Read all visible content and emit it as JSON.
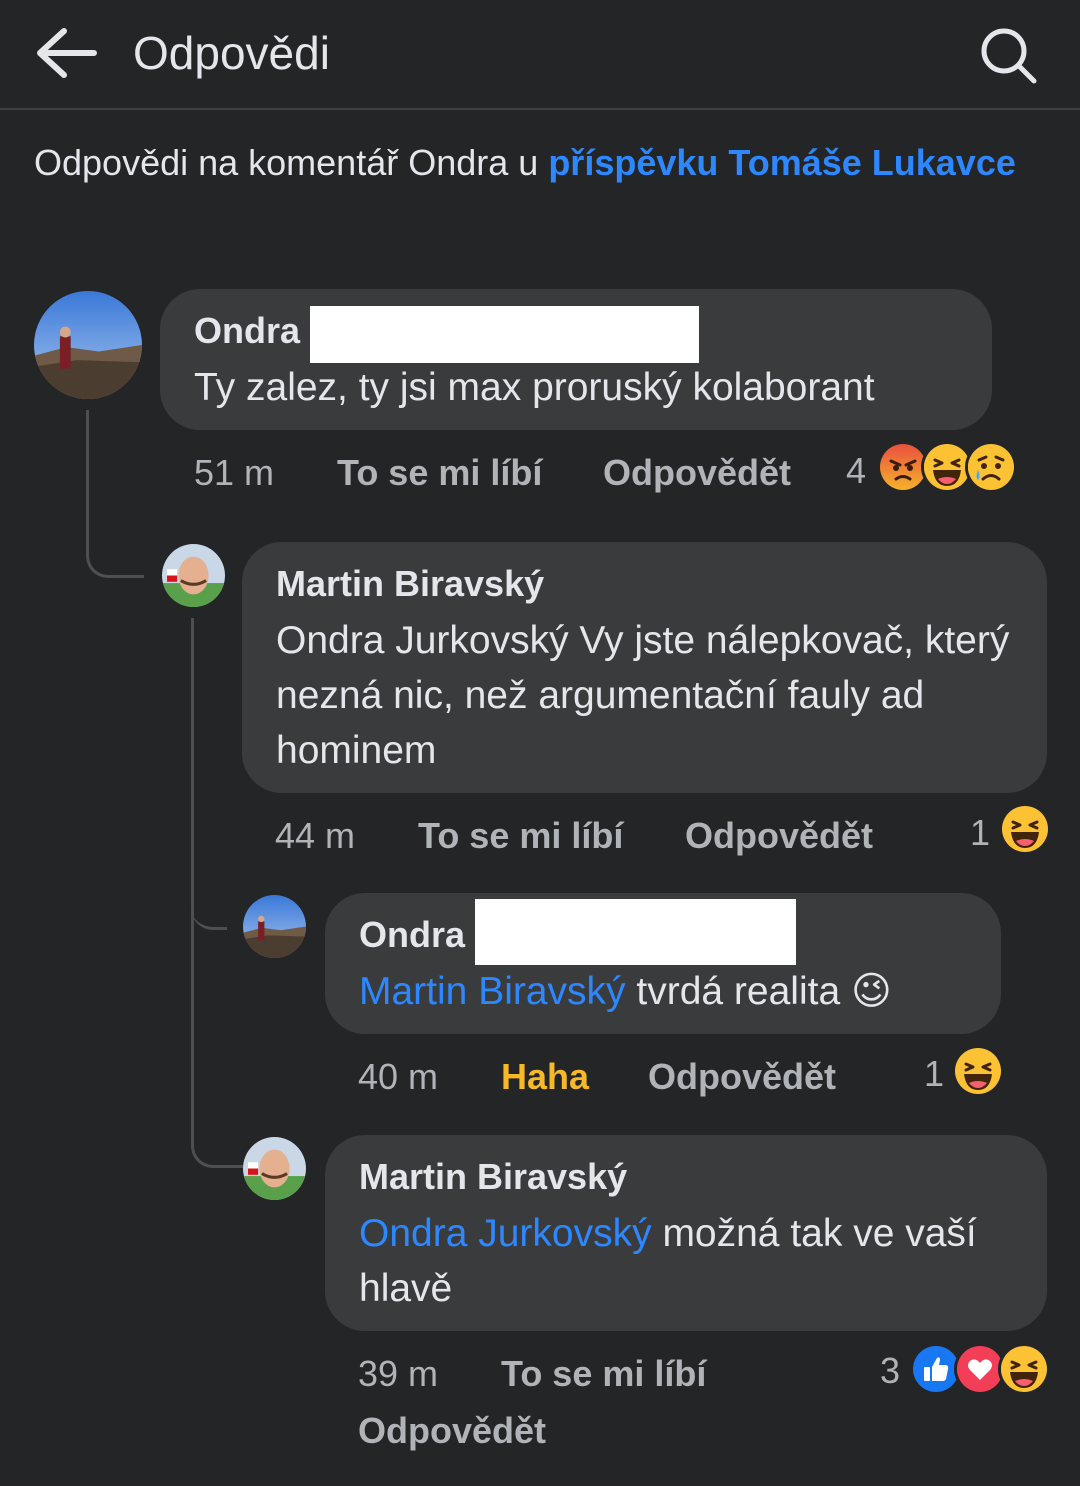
{
  "header": {
    "title": "Odpovědi"
  },
  "context": {
    "prefix": "Odpovědi na komentář Ondra u ",
    "link": "příspěvku Tomáše Lukavce"
  },
  "comments": [
    {
      "author": "Ondra",
      "text": "Ty zalez, ty jsi max proruský kolaborant",
      "time": "51 m",
      "like": "To se mi líbí",
      "reply": "Odpovědět",
      "reaction_count": "4",
      "reactions": [
        "angry",
        "haha",
        "sad"
      ]
    },
    {
      "author": "Martin Biravský",
      "text": "Ondra Jurkovský Vy jste nálepkovač, který nezná nic, než argumentační fauly ad hominem",
      "time": "44 m",
      "like": "To se mi líbí",
      "reply": "Odpovědět",
      "reaction_count": "1",
      "reactions": [
        "haha"
      ]
    },
    {
      "author": "Ondra",
      "mention": "Martin Biravský",
      "text": " tvrdá realita 😉",
      "time": "40 m",
      "like": "Haha",
      "reply": "Odpovědět",
      "reaction_count": "1",
      "reactions": [
        "haha"
      ]
    },
    {
      "author": "Martin Biravský",
      "mention": "Ondra Jurkovský",
      "text": " možná tak ve vaší hlavě",
      "time": "39 m",
      "like": "To se mi líbí",
      "reply": "Odpovědět",
      "reaction_count": "3",
      "reactions": [
        "like",
        "love",
        "haha"
      ]
    }
  ],
  "colors": {
    "background": "#242526",
    "bubble": "#3a3b3c",
    "link": "#2d88ff",
    "haha_active": "#f7b928",
    "secondary_text": "#b0b3b8"
  }
}
